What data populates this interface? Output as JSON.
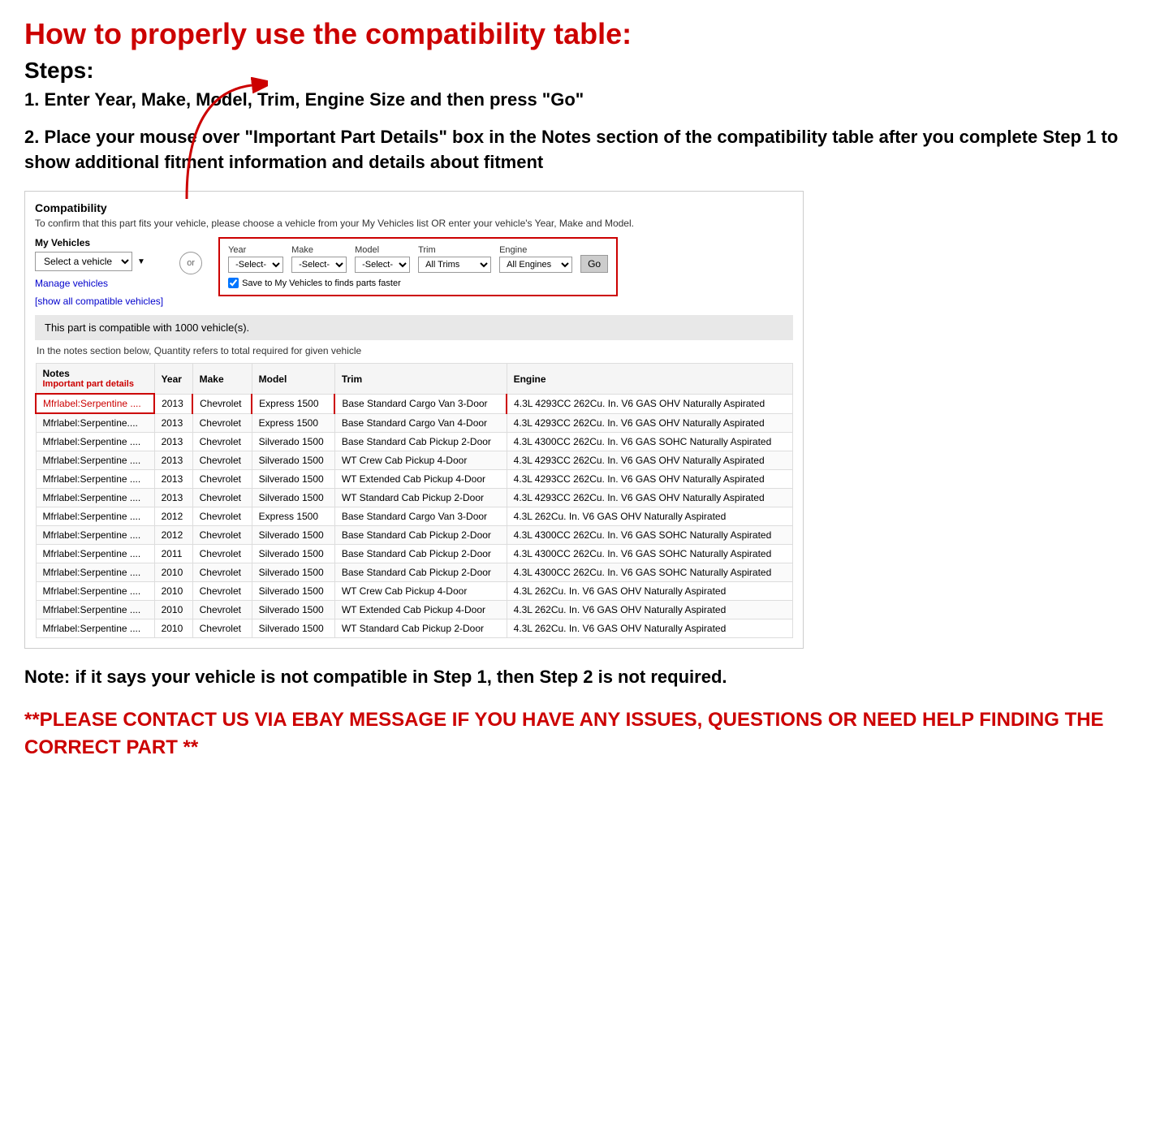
{
  "title": "How to properly use the compatibility table:",
  "steps_label": "Steps:",
  "step1": "1. Enter Year, Make, Model, Trim, Engine Size and then press \"Go\"",
  "step2": "2. Place your mouse over \"Important Part Details\" box in the Notes section of the compatibility table after you complete Step 1 to show additional fitment information and details about fitment",
  "compatibility": {
    "section_title": "Compatibility",
    "subtitle": "To confirm that this part fits your vehicle, please choose a vehicle from your My Vehicles list OR enter your vehicle's Year, Make and Model.",
    "my_vehicles_label": "My Vehicles",
    "select_vehicle_placeholder": "Select a vehicle",
    "or_label": "or",
    "manage_vehicles": "Manage vehicles",
    "show_all": "[show all compatible vehicles]",
    "year_label": "Year",
    "make_label": "Make",
    "model_label": "Model",
    "trim_label": "Trim",
    "engine_label": "Engine",
    "year_default": "-Select-",
    "make_default": "-Select-",
    "model_default": "-Select-",
    "trim_default": "All Trims",
    "engine_default": "All Engines",
    "go_button": "Go",
    "save_checkbox_label": "Save to My Vehicles to finds parts faster",
    "compatible_count": "This part is compatible with 1000 vehicle(s).",
    "quantity_note": "In the notes section below, Quantity refers to total required for given vehicle",
    "table_headers": [
      "Notes",
      "Year",
      "Make",
      "Model",
      "Trim",
      "Engine"
    ],
    "notes_header_sub": "Important part details",
    "rows": [
      {
        "notes": "Mfrlabel:Serpentine ....",
        "year": "2013",
        "make": "Chevrolet",
        "model": "Express 1500",
        "trim": "Base Standard Cargo Van 3-Door",
        "engine": "4.3L 4293CC 262Cu. In. V6 GAS OHV Naturally Aspirated",
        "highlight": true
      },
      {
        "notes": "Mfrlabel:Serpentine....",
        "year": "2013",
        "make": "Chevrolet",
        "model": "Express 1500",
        "trim": "Base Standard Cargo Van 4-Door",
        "engine": "4.3L 4293CC 262Cu. In. V6 GAS OHV Naturally Aspirated",
        "highlight": false
      },
      {
        "notes": "Mfrlabel:Serpentine ....",
        "year": "2013",
        "make": "Chevrolet",
        "model": "Silverado 1500",
        "trim": "Base Standard Cab Pickup 2-Door",
        "engine": "4.3L 4300CC 262Cu. In. V6 GAS SOHC Naturally Aspirated",
        "highlight": false
      },
      {
        "notes": "Mfrlabel:Serpentine ....",
        "year": "2013",
        "make": "Chevrolet",
        "model": "Silverado 1500",
        "trim": "WT Crew Cab Pickup 4-Door",
        "engine": "4.3L 4293CC 262Cu. In. V6 GAS OHV Naturally Aspirated",
        "highlight": false
      },
      {
        "notes": "Mfrlabel:Serpentine ....",
        "year": "2013",
        "make": "Chevrolet",
        "model": "Silverado 1500",
        "trim": "WT Extended Cab Pickup 4-Door",
        "engine": "4.3L 4293CC 262Cu. In. V6 GAS OHV Naturally Aspirated",
        "highlight": false
      },
      {
        "notes": "Mfrlabel:Serpentine ....",
        "year": "2013",
        "make": "Chevrolet",
        "model": "Silverado 1500",
        "trim": "WT Standard Cab Pickup 2-Door",
        "engine": "4.3L 4293CC 262Cu. In. V6 GAS OHV Naturally Aspirated",
        "highlight": false
      },
      {
        "notes": "Mfrlabel:Serpentine ....",
        "year": "2012",
        "make": "Chevrolet",
        "model": "Express 1500",
        "trim": "Base Standard Cargo Van 3-Door",
        "engine": "4.3L 262Cu. In. V6 GAS OHV Naturally Aspirated",
        "highlight": false
      },
      {
        "notes": "Mfrlabel:Serpentine ....",
        "year": "2012",
        "make": "Chevrolet",
        "model": "Silverado 1500",
        "trim": "Base Standard Cab Pickup 2-Door",
        "engine": "4.3L 4300CC 262Cu. In. V6 GAS SOHC Naturally Aspirated",
        "highlight": false
      },
      {
        "notes": "Mfrlabel:Serpentine ....",
        "year": "2011",
        "make": "Chevrolet",
        "model": "Silverado 1500",
        "trim": "Base Standard Cab Pickup 2-Door",
        "engine": "4.3L 4300CC 262Cu. In. V6 GAS SOHC Naturally Aspirated",
        "highlight": false
      },
      {
        "notes": "Mfrlabel:Serpentine ....",
        "year": "2010",
        "make": "Chevrolet",
        "model": "Silverado 1500",
        "trim": "Base Standard Cab Pickup 2-Door",
        "engine": "4.3L 4300CC 262Cu. In. V6 GAS SOHC Naturally Aspirated",
        "highlight": false
      },
      {
        "notes": "Mfrlabel:Serpentine ....",
        "year": "2010",
        "make": "Chevrolet",
        "model": "Silverado 1500",
        "trim": "WT Crew Cab Pickup 4-Door",
        "engine": "4.3L 262Cu. In. V6 GAS OHV Naturally Aspirated",
        "highlight": false
      },
      {
        "notes": "Mfrlabel:Serpentine ....",
        "year": "2010",
        "make": "Chevrolet",
        "model": "Silverado 1500",
        "trim": "WT Extended Cab Pickup 4-Door",
        "engine": "4.3L 262Cu. In. V6 GAS OHV Naturally Aspirated",
        "highlight": false
      },
      {
        "notes": "Mfrlabel:Serpentine ....",
        "year": "2010",
        "make": "Chevrolet",
        "model": "Silverado 1500",
        "trim": "WT Standard Cab Pickup 2-Door",
        "engine": "4.3L 262Cu. In. V6 GAS OHV Naturally Aspirated",
        "highlight": false
      }
    ]
  },
  "note_text": "Note: if it says your vehicle is not compatible in Step 1, then Step 2 is not required.",
  "contact_text": "**PLEASE CONTACT US VIA EBAY MESSAGE IF YOU HAVE ANY ISSUES, QUESTIONS OR NEED HELP FINDING THE CORRECT PART **"
}
